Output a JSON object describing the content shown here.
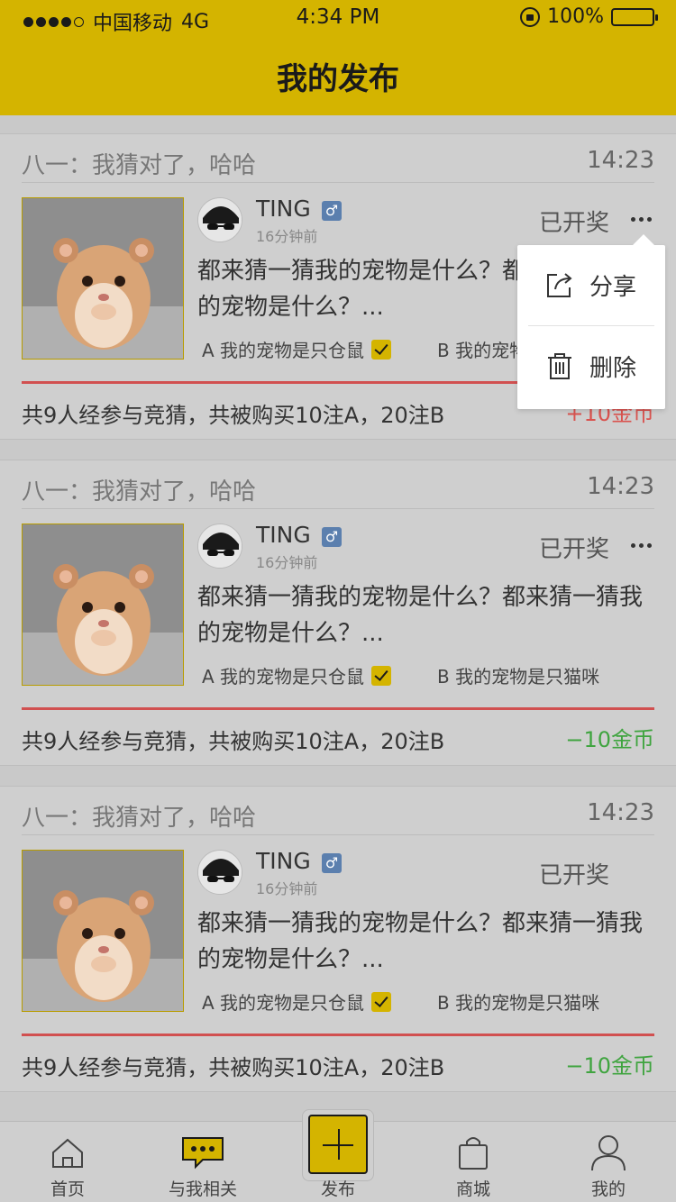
{
  "status_bar": {
    "carrier": "中国移动",
    "network": "4G",
    "time": "4:34 PM",
    "battery": "100%"
  },
  "header": {
    "title": "我的发布"
  },
  "cards": [
    {
      "guess_text": "八一：我猜对了，哈哈",
      "time": "14:23",
      "username": "TING",
      "gender": "♂",
      "posted": "16分钟前",
      "status": "已开奖",
      "question": "都来猜一猜我的宠物是什么？都来猜一猜我的宠物是什么？...",
      "option_a": "A 我的宠物是只仓鼠",
      "option_b": "B 我的宠物是只猫咪",
      "summary": "共9人经参与竞猜，共被购买10注A，20注B",
      "coins": "+10金币",
      "coins_color": "#d9534f"
    },
    {
      "guess_text": "八一：我猜对了，哈哈",
      "time": "14:23",
      "username": "TING",
      "gender": "♂",
      "posted": "16分钟前",
      "status": "已开奖",
      "question": "都来猜一猜我的宠物是什么？都来猜一猜我的宠物是什么？...",
      "option_a": "A 我的宠物是只仓鼠",
      "option_b": "B 我的宠物是只猫咪",
      "summary": "共9人经参与竞猜，共被购买10注A，20注B",
      "coins": "−10金币",
      "coins_color": "#3fa43f"
    },
    {
      "guess_text": "八一：我猜对了，哈哈",
      "time": "14:23",
      "username": "TING",
      "gender": "♂",
      "posted": "16分钟前",
      "status": "已开奖",
      "question": "都来猜一猜我的宠物是什么？都来猜一猜我的宠物是什么？...",
      "option_a": "A 我的宠物是只仓鼠",
      "option_b": "B 我的宠物是只猫咪",
      "summary": "共9人经参与竞猜，共被购买10注A，20注B",
      "coins": "−10金币",
      "coins_color": "#3fa43f"
    }
  ],
  "popup": {
    "share_label": "分享",
    "delete_label": "删除"
  },
  "tabbar": {
    "home": "首页",
    "related": "与我相关",
    "publish": "发布",
    "mall": "商城",
    "mine": "我的"
  },
  "colors": {
    "brand_yellow": "#d4b400",
    "divider_red": "#d15050",
    "gain_red": "#d9534f",
    "loss_green": "#3fa43f"
  }
}
